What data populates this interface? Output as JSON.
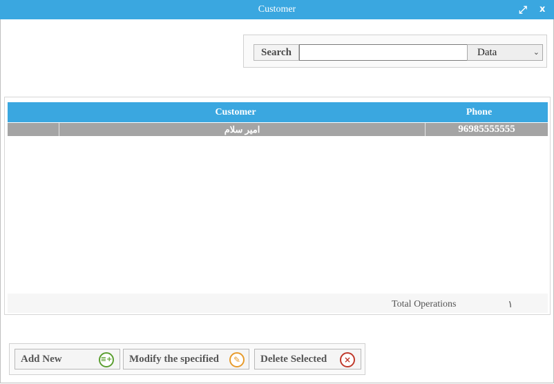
{
  "window": {
    "title": "Customer",
    "maximize_icon": "⤢",
    "close_label": "x"
  },
  "search": {
    "label": "Search",
    "value": "",
    "placeholder": "",
    "filter_selected": "Data",
    "chevron_icon": "chevron-down-icon"
  },
  "grid": {
    "columns": [
      "Customer",
      "Phone"
    ],
    "rows": [
      {
        "customer": "امير سلام",
        "phone": "96985555555"
      }
    ],
    "footer": {
      "total_label": "Total Operations",
      "total_value": "١"
    }
  },
  "toolbar": {
    "add_label": "Add New",
    "modify_label": "Modify the specified",
    "delete_label": "Delete Selected"
  },
  "colors": {
    "accent": "#3aa7e0",
    "row_selected": "#a4a4a4",
    "add_icon": "#5a9e2f",
    "modify_icon": "#e79a2a",
    "delete_icon": "#c0392b"
  }
}
